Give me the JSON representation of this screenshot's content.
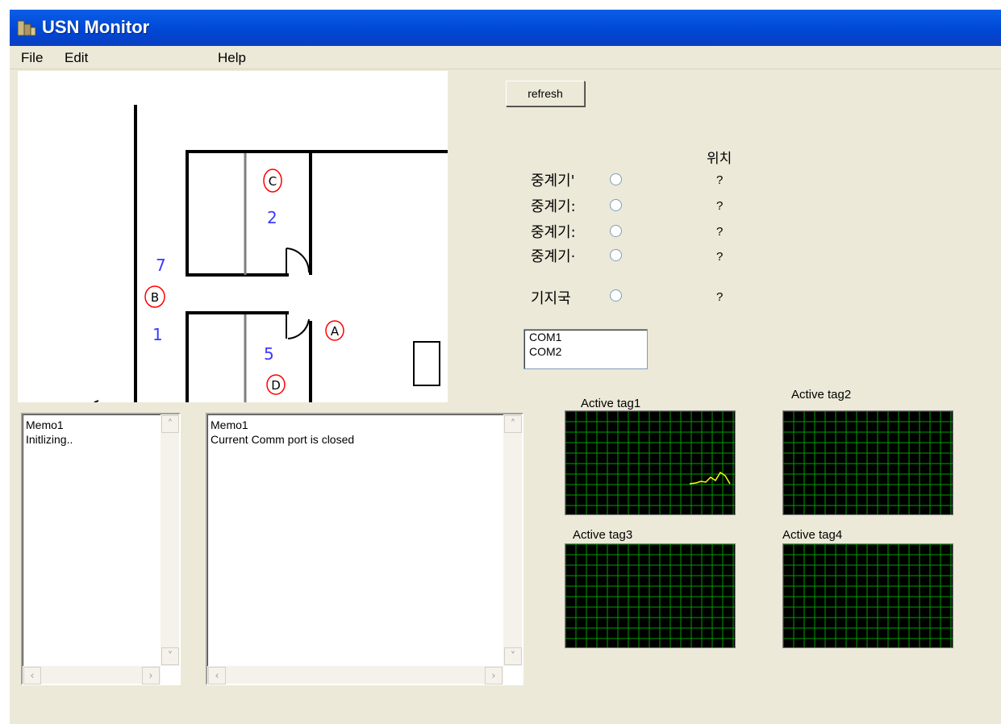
{
  "window": {
    "title": "USN Monitor"
  },
  "menu": {
    "file": "File",
    "edit": "Edit",
    "help": "Help"
  },
  "map": {
    "room_numbers": [
      "2",
      "7",
      "1",
      "5"
    ],
    "markers": [
      "C",
      "B",
      "A",
      "D"
    ]
  },
  "refresh_button": "refresh",
  "position_header": "위치",
  "relays": [
    {
      "label": "중계기'",
      "position": "?"
    },
    {
      "label": "중계기:",
      "position": "?"
    },
    {
      "label": "중계기:",
      "position": "?"
    },
    {
      "label": "중계기·",
      "position": "?"
    }
  ],
  "base_station": {
    "label": "기지국",
    "position": "?"
  },
  "com_ports": [
    "COM1",
    "COM2"
  ],
  "memo1": {
    "text": "Memo1\nInitlizing.."
  },
  "memo2": {
    "text": "Memo1\nCurrent Comm port is closed"
  },
  "tags": [
    "Active tag1",
    "Active tag2",
    "Active tag3",
    "Active tag4"
  ],
  "colors": {
    "graph_grid": "#00a000",
    "graph_trace": "#ffff00",
    "map_number": "#3a3aff",
    "map_marker": "#ff0000"
  }
}
